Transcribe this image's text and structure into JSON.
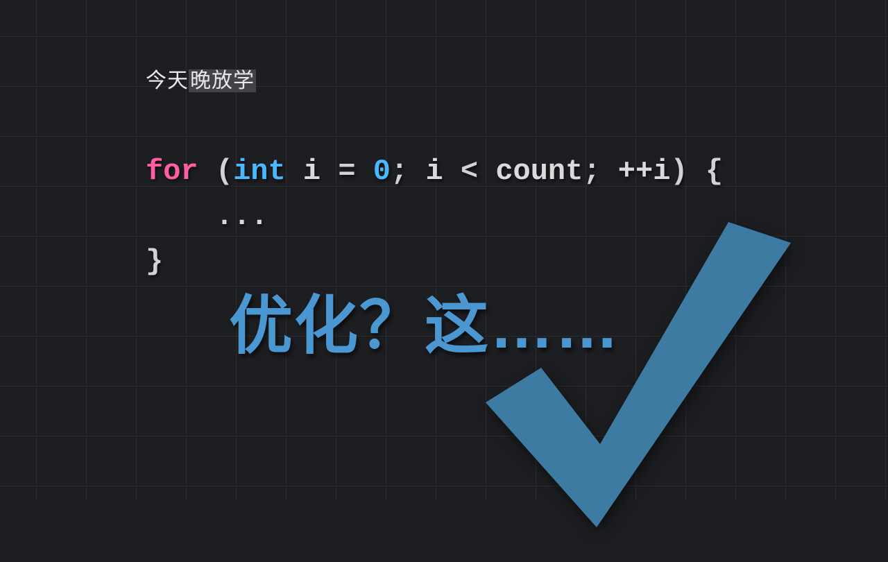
{
  "caption": {
    "plain": "今天",
    "highlight": "晚放学"
  },
  "code": {
    "line1": {
      "kw": "for",
      "sp1": " ",
      "paren_open": "(",
      "type": "int",
      "sp2": " ",
      "var1": "i",
      "sp3": " ",
      "eq": "=",
      "sp4": " ",
      "num": "0",
      "semi1": ";",
      "sp5": " ",
      "var2": "i",
      "sp6": " ",
      "lt": "<",
      "sp7": " ",
      "count": "count",
      "semi2": ";",
      "sp8": " ",
      "inc": "++i",
      "paren_close": ")",
      "sp9": " ",
      "brace_open": "{"
    },
    "line2": {
      "indent": "    ",
      "body": "..."
    },
    "line3": {
      "brace_close": "}"
    }
  },
  "headline": "优化？这……",
  "checkmark_name": "checkmark-icon"
}
